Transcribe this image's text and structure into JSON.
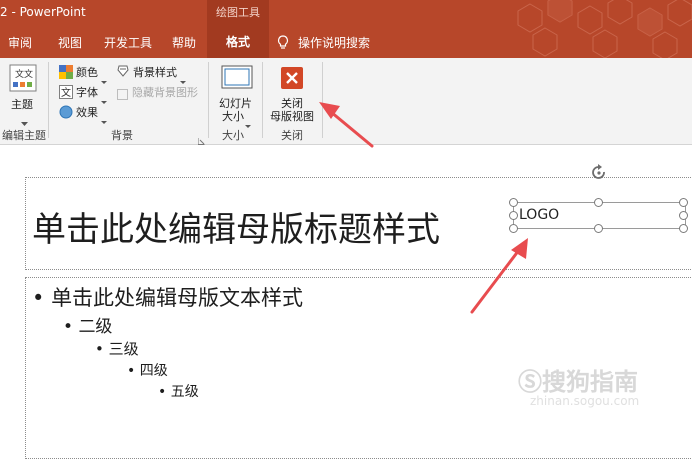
{
  "window": {
    "title": "2  -  PowerPoint",
    "context_tab_group": "绘图工具"
  },
  "tabs": [
    {
      "label": "审阅"
    },
    {
      "label": "视图"
    },
    {
      "label": "开发工具"
    },
    {
      "label": "帮助"
    },
    {
      "label": "格式",
      "active": true
    },
    {
      "label": "操作说明搜索",
      "icon": "lightbulb-icon"
    }
  ],
  "ribbon": {
    "edit_theme": {
      "theme_label": "主题",
      "theme_icon": "theme-icon",
      "group_label": "编辑主题"
    },
    "background": {
      "colors_label": "颜色",
      "fonts_label": "字体",
      "effects_label": "效果",
      "bg_styles_label": "背景样式",
      "hide_bg_label": "隐藏背景图形",
      "group_label": "背景"
    },
    "size": {
      "slide_size_line1": "幻灯片",
      "slide_size_line2": "大小",
      "group_label": "大小"
    },
    "close": {
      "close_line1": "关闭",
      "close_line2": "母版视图",
      "group_label": "关闭",
      "close_icon": "close-icon"
    }
  },
  "slide": {
    "title_placeholder": "单击此处编辑母版标题样式",
    "text_levels": [
      {
        "label": "单击此处编辑母版文本样式"
      },
      {
        "label": "二级"
      },
      {
        "label": "三级"
      },
      {
        "label": "四级"
      },
      {
        "label": "五级"
      }
    ],
    "logo_text": "LOGO"
  },
  "watermark": {
    "main": "搜狗指南",
    "sub": "zhinan.sogou.com"
  },
  "colors": {
    "accent": "#b7472a",
    "context_tab": "#a23a20",
    "arrow": "#e84c4f",
    "close_icon_bg": "#d24726"
  }
}
